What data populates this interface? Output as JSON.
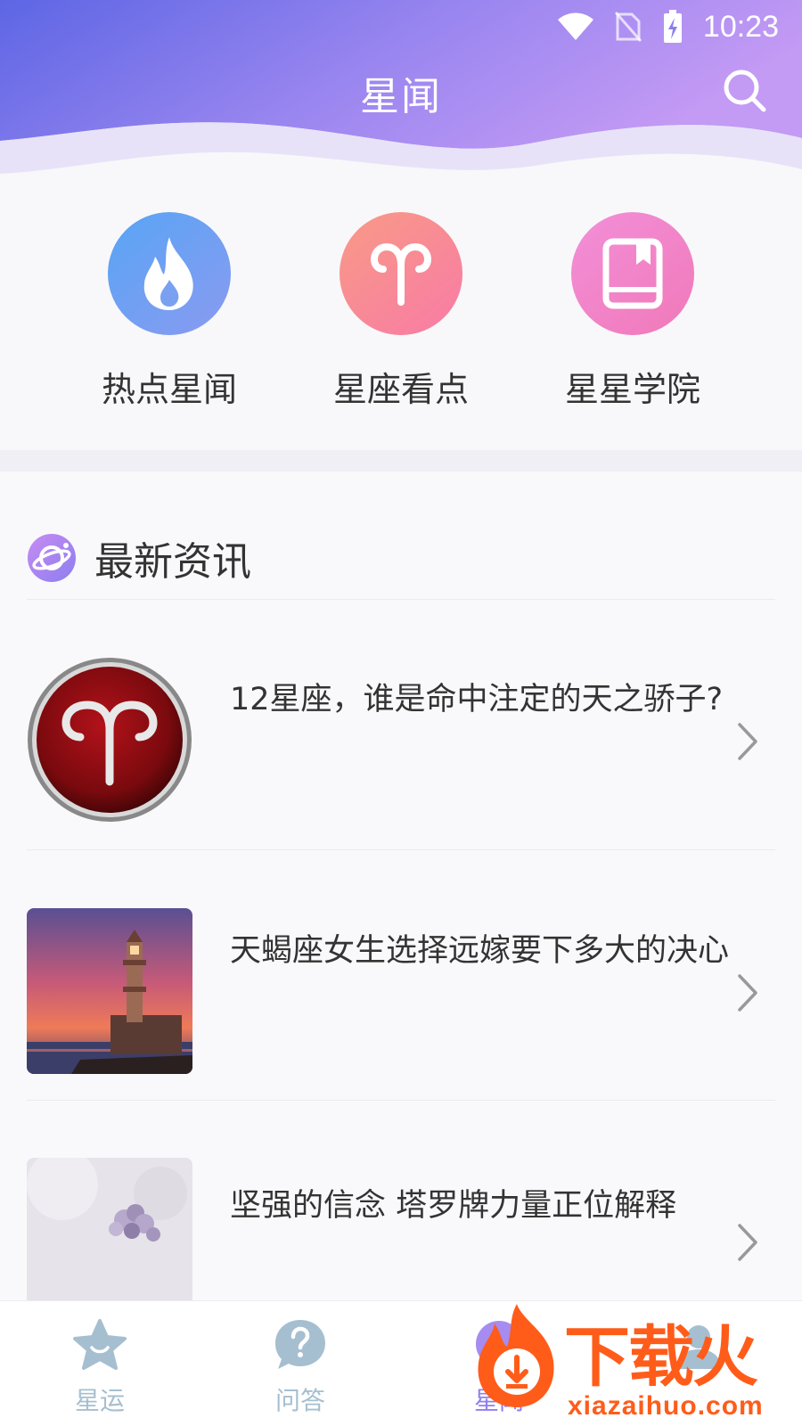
{
  "status_bar": {
    "time": "10:23"
  },
  "header": {
    "title": "星闻"
  },
  "categories": [
    {
      "label": "热点星闻",
      "icon": "flame-icon"
    },
    {
      "label": "星座看点",
      "icon": "aries-icon"
    },
    {
      "label": "星星学院",
      "icon": "book-icon"
    }
  ],
  "news": {
    "section_title": "最新资讯",
    "items": [
      {
        "title": "12星座，谁是命中注定的天之骄子?",
        "thumb": "aries-emblem-image"
      },
      {
        "title": "天蝎座女生选择远嫁要下多大的决心",
        "thumb": "lighthouse-sunset-image"
      },
      {
        "title": "坚强的信念 塔罗牌力量正位解释",
        "thumb": "flowers-image"
      }
    ]
  },
  "tabs": [
    {
      "label": "星运",
      "icon": "star-icon"
    },
    {
      "label": "问答",
      "icon": "question-bubble-icon"
    },
    {
      "label": "星闻",
      "icon": "planet-icon"
    },
    {
      "label": "",
      "icon": "profile-icon"
    }
  ],
  "watermark": {
    "brand": "下载火",
    "url": "xiazaihuo.com"
  },
  "colors": {
    "header_gradient_start": "#5f66e6",
    "header_gradient_end": "#b995f3",
    "tab_inactive": "#a6bfd0",
    "watermark": "#ff5c1a"
  }
}
